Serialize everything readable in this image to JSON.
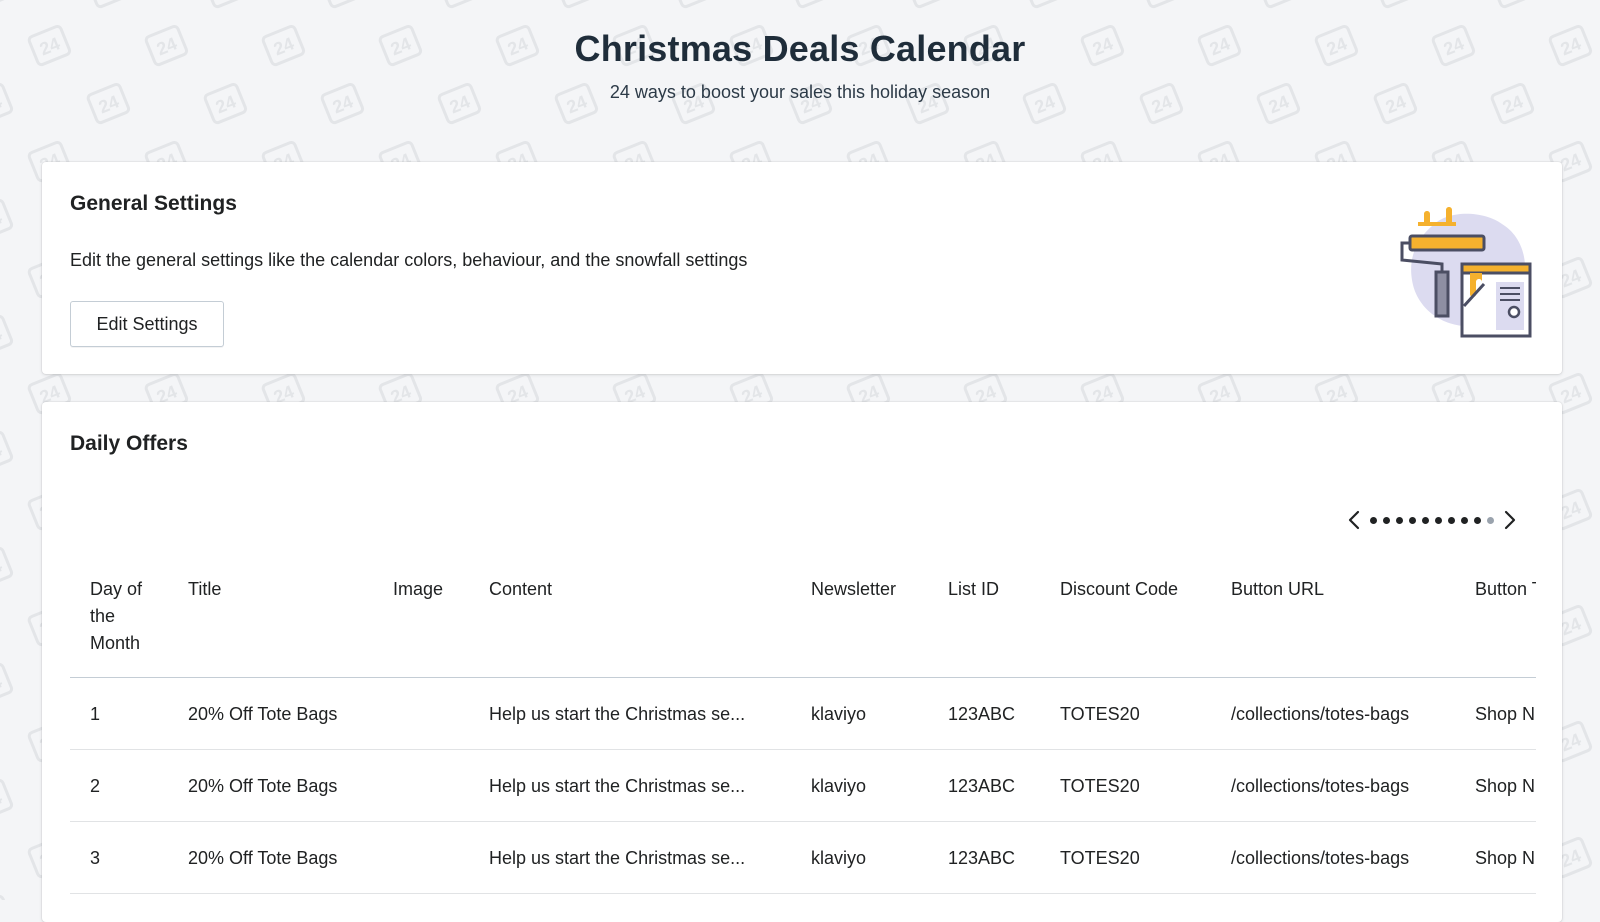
{
  "header": {
    "title": "Christmas Deals Calendar",
    "subtitle": "24 ways to boost your sales this holiday season",
    "watermark_text": "24"
  },
  "settings_card": {
    "heading": "General Settings",
    "description": "Edit the general settings like the calendar colors, behaviour, and the snowfall settings",
    "button_label": "Edit Settings",
    "illustration_icon": "paint-roller-canvas-illustration"
  },
  "offers_card": {
    "heading": "Daily Offers",
    "pager": {
      "prev_icon": "chevron-left-icon",
      "next_icon": "chevron-right-icon",
      "dot_count": 10,
      "active_dots": 9
    },
    "columns": [
      "Day of the Month",
      "Title",
      "Image",
      "Content",
      "Newsletter",
      "List ID",
      "Discount Code",
      "Button URL",
      "Button Text"
    ],
    "rows": [
      {
        "day": "1",
        "title": "20% Off Tote Bags",
        "image": "",
        "content": "Help us start the Christmas se...",
        "newsletter": "klaviyo",
        "list_id": "123ABC",
        "discount_code": "TOTES20",
        "button_url": "/collections/totes-bags",
        "button_text": "Shop N"
      },
      {
        "day": "2",
        "title": "20% Off Tote Bags",
        "image": "",
        "content": "Help us start the Christmas se...",
        "newsletter": "klaviyo",
        "list_id": "123ABC",
        "discount_code": "TOTES20",
        "button_url": "/collections/totes-bags",
        "button_text": "Shop N"
      },
      {
        "day": "3",
        "title": "20% Off Tote Bags",
        "image": "",
        "content": "Help us start the Christmas se...",
        "newsletter": "klaviyo",
        "list_id": "123ABC",
        "discount_code": "TOTES20",
        "button_url": "/collections/totes-bags",
        "button_text": "Shop N"
      }
    ]
  },
  "colors": {
    "page_background": "#f4f5f7",
    "heading_text": "#1f2d3a",
    "illustration_accent": "#f5b12e",
    "illustration_blob": "#dcdbf0"
  }
}
